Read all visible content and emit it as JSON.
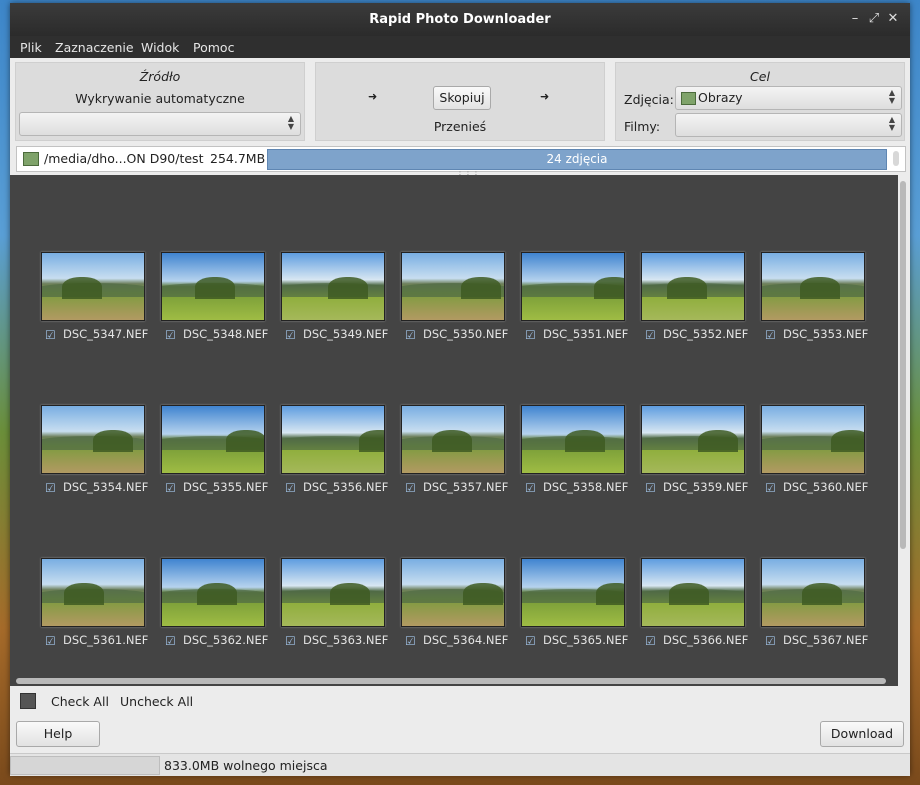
{
  "window": {
    "title": "Rapid Photo Downloader"
  },
  "menu": [
    "Plik",
    "Zaznaczenie",
    "Widok",
    "Pomoc"
  ],
  "source": {
    "heading": "Źródło",
    "mode": "Wykrywanie automatyczne",
    "combo_value": ""
  },
  "transfer": {
    "copy_label": "Skopiuj",
    "move_label": "Przenieś"
  },
  "destination": {
    "heading": "Cel",
    "photos_label": "Zdjęcia:",
    "photos_value": "Obrazy",
    "videos_label": "Filmy:",
    "videos_value": ""
  },
  "source_bar": {
    "path": "/media/dho...ON D90/test",
    "size": "254.7MB",
    "progress_label": "24 zdjęcia",
    "progress": 1.0
  },
  "thumbnails": [
    "DSC_5347.NEF",
    "DSC_5348.NEF",
    "DSC_5349.NEF",
    "DSC_5350.NEF",
    "DSC_5351.NEF",
    "DSC_5352.NEF",
    "DSC_5353.NEF",
    "DSC_5354.NEF",
    "DSC_5355.NEF",
    "DSC_5356.NEF",
    "DSC_5357.NEF",
    "DSC_5358.NEF",
    "DSC_5359.NEF",
    "DSC_5360.NEF",
    "DSC_5361.NEF",
    "DSC_5362.NEF",
    "DSC_5363.NEF",
    "DSC_5364.NEF",
    "DSC_5365.NEF",
    "DSC_5366.NEF",
    "DSC_5367.NEF"
  ],
  "selection": {
    "check_all": "Check All",
    "uncheck_all": "Uncheck All"
  },
  "buttons": {
    "help": "Help",
    "download": "Download"
  },
  "status": {
    "free_space": "833.0MB wolnego miejsca"
  },
  "icons": {
    "folder": "folder-icon",
    "checkbox": "checkbox-checked-icon",
    "arrow": "arrow-right-icon"
  }
}
